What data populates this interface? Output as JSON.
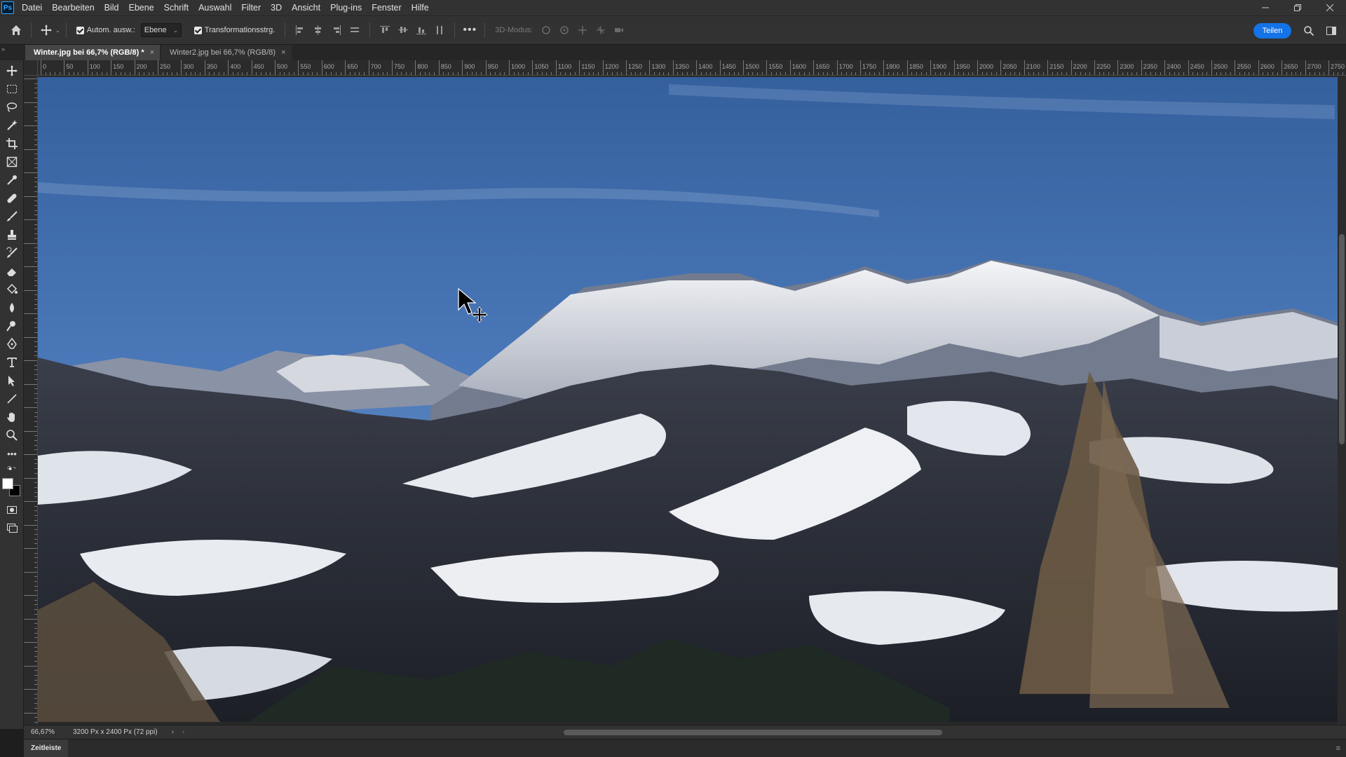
{
  "app": {
    "logo": "Ps"
  },
  "menu": [
    "Datei",
    "Bearbeiten",
    "Bild",
    "Ebene",
    "Schrift",
    "Auswahl",
    "Filter",
    "3D",
    "Ansicht",
    "Plug-ins",
    "Fenster",
    "Hilfe"
  ],
  "options": {
    "auto_select_label": "Autom. ausw.:",
    "layer_select_value": "Ebene",
    "transform_label": "Transformationsstrg.",
    "mode_3d_label": "3D-Modus:",
    "share_label": "Teilen"
  },
  "tabs": [
    {
      "label": "Winter.jpg bei 66,7% (RGB/8) *",
      "active": true
    },
    {
      "label": "Winter2.jpg bei 66,7% (RGB/8)",
      "active": false
    }
  ],
  "ruler": {
    "h_labels": [
      "0",
      "50",
      "100",
      "150",
      "200",
      "250",
      "300",
      "350",
      "400",
      "450",
      "500",
      "550",
      "600",
      "650",
      "700",
      "750",
      "800",
      "850",
      "900",
      "950",
      "1000",
      "1050",
      "1100",
      "1150",
      "1200",
      "1250",
      "1300",
      "1350",
      "1400",
      "1450",
      "1500",
      "1550",
      "1600",
      "1650",
      "1700",
      "1750",
      "1800",
      "1850",
      "1900",
      "1950",
      "2000",
      "2050",
      "2100",
      "2150",
      "2200",
      "2250",
      "2300",
      "2350",
      "2400",
      "2450",
      "2500",
      "2550",
      "2600",
      "2650",
      "2700",
      "2750"
    ]
  },
  "status": {
    "zoom": "66,67%",
    "doc_info": "3200 Px x 2400 Px (72 ppi)"
  },
  "timeline": {
    "label": "Zeitleiste"
  },
  "icons": {
    "home": "home-icon",
    "move": "move-tool-icon",
    "search": "search-icon",
    "workspace": "workspace-icon"
  },
  "colors": {
    "accent": "#1473e6",
    "foreground_color": "#ffffff",
    "background_color": "#000000"
  }
}
